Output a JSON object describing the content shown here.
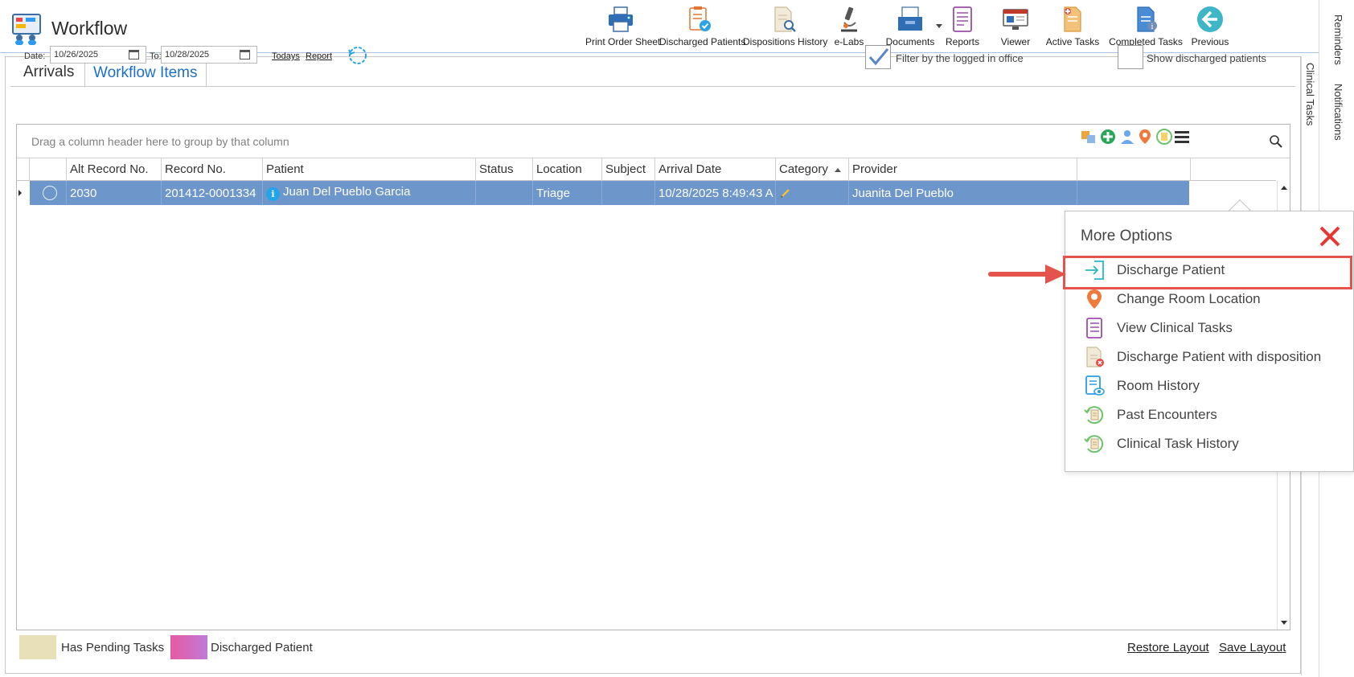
{
  "app": {
    "title": "Workflow"
  },
  "toolbar": {
    "items": [
      {
        "label": "Print Order Sheet",
        "icon": "printer-icon"
      },
      {
        "label": "Discharged Patients",
        "icon": "clipboard-check-icon"
      },
      {
        "label": "Dispositions History",
        "icon": "document-search-icon"
      },
      {
        "label": "e-Labs",
        "icon": "microscope-icon"
      },
      {
        "label": "Documents",
        "icon": "document-tray-icon"
      },
      {
        "label": "Reports",
        "icon": "report-icon"
      },
      {
        "label": "Viewer",
        "icon": "viewer-icon"
      },
      {
        "label": "Active Tasks",
        "icon": "active-tasks-icon"
      },
      {
        "label": "Completed Tasks",
        "icon": "completed-tasks-icon"
      },
      {
        "label": "Previous",
        "icon": "back-arrow-icon"
      }
    ]
  },
  "side_tabs": {
    "reminders": "Reminders",
    "notifications": "Notifications",
    "clinical_tasks": "Clinical Tasks"
  },
  "tabs": [
    {
      "label": "Arrivals",
      "active": false
    },
    {
      "label": "Workflow Items",
      "active": true
    }
  ],
  "filters": {
    "date_label": "Date:",
    "date_from": "10/26/2025",
    "to_label": "To:",
    "date_to": "10/28/2025",
    "todays_link": "Todays",
    "report_link": "Report",
    "filter_office": {
      "label": "Filter by the logged in office",
      "checked": true
    },
    "show_discharged": {
      "label": "Show discharged patients",
      "checked": false
    }
  },
  "grid": {
    "group_panel_text": "Drag a column header here to group by that column",
    "columns": [
      "Alt Record No.",
      "Record No.",
      "Patient",
      "Status",
      "Location",
      "Subject",
      "Arrival Date",
      "Category",
      "Provider"
    ],
    "sorted_column": "Category",
    "rows": [
      {
        "alt_record_no": "2030",
        "record_no": "201412-0001334",
        "patient": "Juan Del Pueblo Garcia",
        "status": "",
        "location": "Triage",
        "subject": "",
        "arrival_date": "10/28/2025 8:49:43 A",
        "category": "",
        "provider": "Juanita Del Pueblo",
        "selected": true
      }
    ]
  },
  "more_options": {
    "title": "More Options",
    "items": [
      {
        "label": "Discharge Patient",
        "icon": "discharge-icon",
        "highlighted": true
      },
      {
        "label": "Change Room Location",
        "icon": "location-pin-icon"
      },
      {
        "label": "View Clinical Tasks",
        "icon": "clinical-tasks-icon"
      },
      {
        "label": "Discharge Patient with disposition",
        "icon": "document-x-icon"
      },
      {
        "label": "Room History",
        "icon": "room-history-icon"
      },
      {
        "label": "Past Encounters",
        "icon": "history-icon"
      },
      {
        "label": "Clinical Task History",
        "icon": "history-icon"
      }
    ]
  },
  "legend": {
    "pending": {
      "label": "Has Pending Tasks",
      "color": "#e8e0b8"
    },
    "discharged": {
      "label": "Discharged Patient",
      "color": "#e55aa2"
    }
  },
  "layout_links": {
    "restore": "Restore Layout",
    "save": "Save Layout"
  },
  "colors": {
    "accent": "#1e6fc8",
    "row_selected": "#6d96cb",
    "highlight": "#e4544c"
  }
}
